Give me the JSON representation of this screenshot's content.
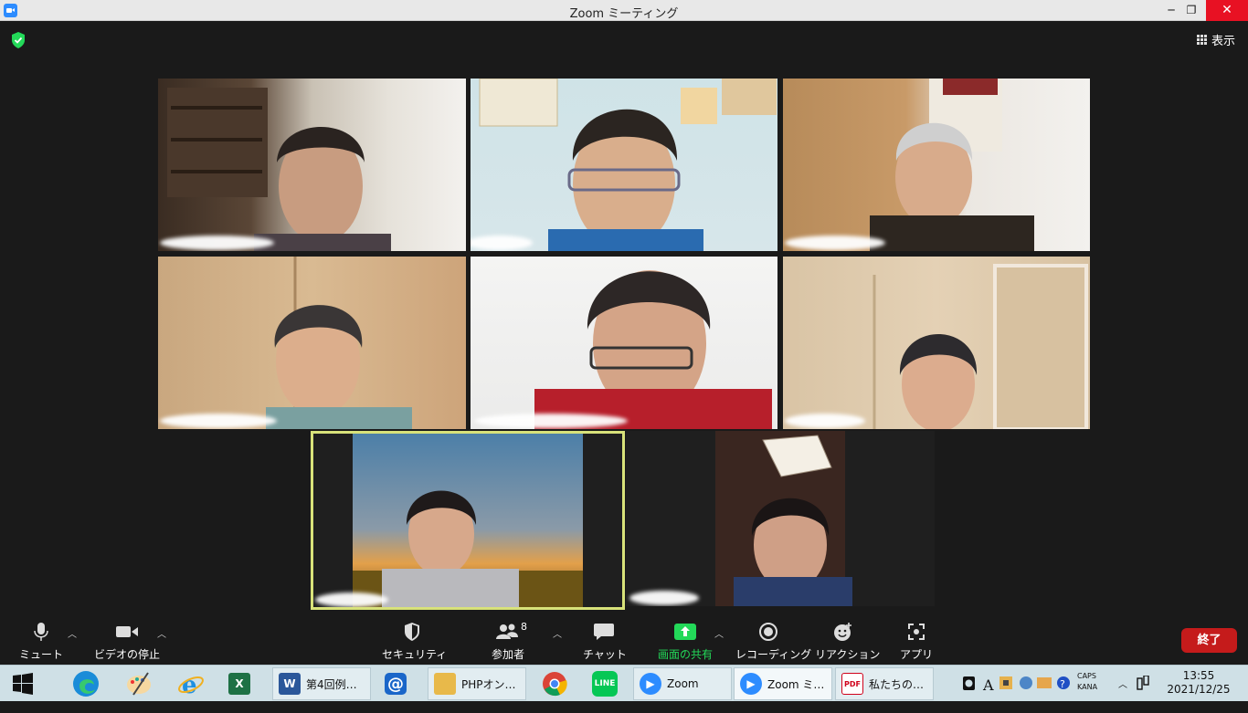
{
  "window": {
    "title": "Zoom ミーティング"
  },
  "header": {
    "view_label": "表示"
  },
  "toolbar": {
    "mute": "ミュート",
    "video": "ビデオの停止",
    "security": "セキュリティ",
    "participants": "参加者",
    "participants_count": "8",
    "chat": "チャット",
    "share": "画面の共有",
    "record": "レコーディング",
    "reaction": "リアクション",
    "apps": "アプリ",
    "end": "終了"
  },
  "colors": {
    "active_speaker_border": "#d8e27a",
    "share_green": "#23d959",
    "end_red": "#c51b1b",
    "zoom_blue": "#2d8cff"
  },
  "taskbar": {
    "word_label": "第4回例…",
    "folder_label": "PHPオン…",
    "zoom_label": "Zoom",
    "zoom_meeting_label": "Zoom ミ…",
    "pdf_label": "私たちの…",
    "time": "13:55",
    "date": "2021/12/25",
    "caps": "CAPS",
    "kana": "KANA"
  }
}
